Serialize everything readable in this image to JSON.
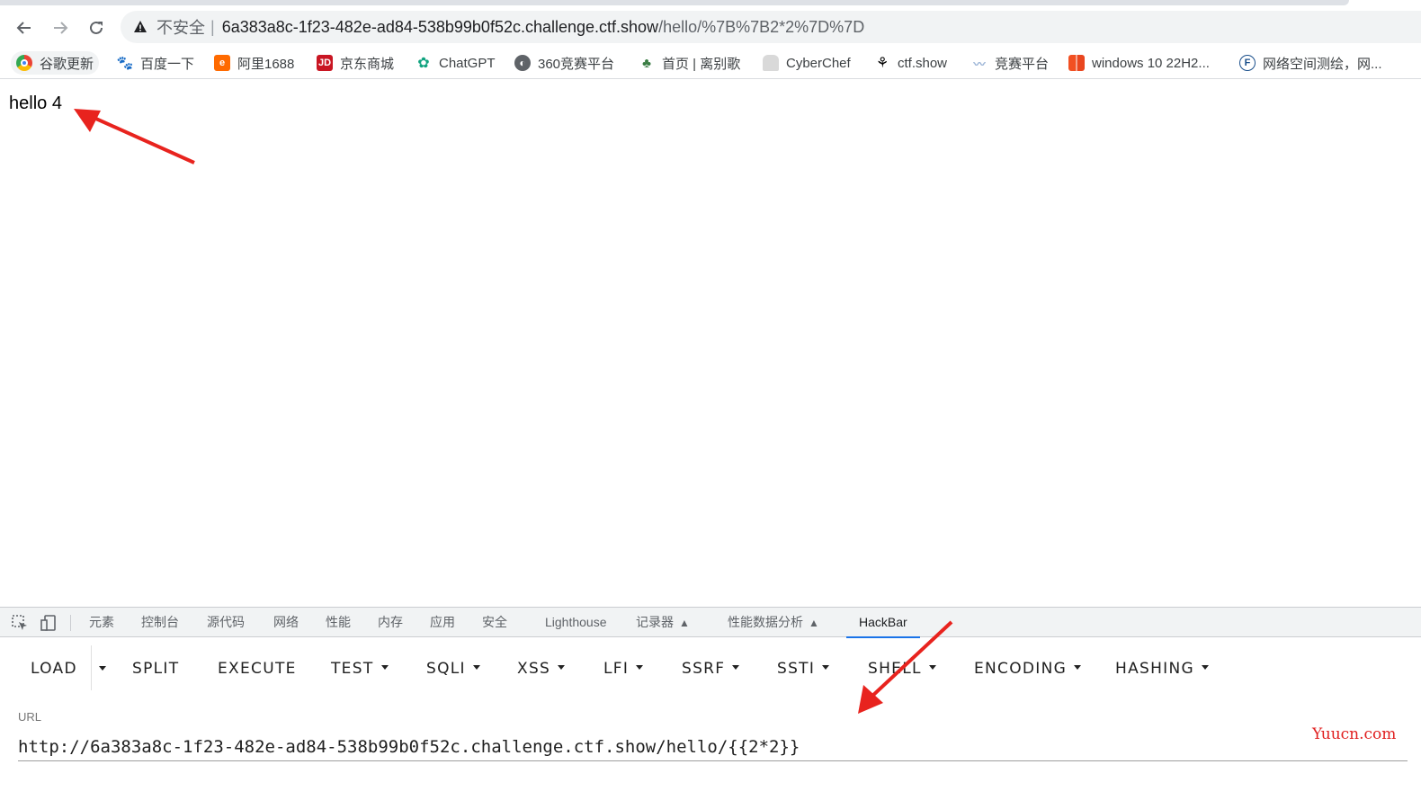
{
  "browser": {
    "address": {
      "insecure_label": "不安全",
      "separator": "|",
      "host": "6a383a8c-1f23-482e-ad84-538b99b0f52c.challenge.ctf.show",
      "path": "/hello/%7B%7B2*2%7D%7D"
    },
    "bookmarks": [
      {
        "label": "谷歌更新",
        "icon": "chrome-icon"
      },
      {
        "label": "百度一下",
        "icon": "baidu-icon"
      },
      {
        "label": "阿里1688",
        "icon": "ali1688-icon"
      },
      {
        "label": "京东商城",
        "icon": "jd-icon"
      },
      {
        "label": "ChatGPT",
        "icon": "chatgpt-icon"
      },
      {
        "label": "360竞赛平台",
        "icon": "globe-icon"
      },
      {
        "label": "首页 | 离别歌",
        "icon": "plant-icon"
      },
      {
        "label": "CyberChef",
        "icon": "chef-hat-icon"
      },
      {
        "label": "ctf.show",
        "icon": "ctfshow-icon"
      },
      {
        "label": "竞赛平台",
        "icon": "wings-icon"
      },
      {
        "label": "windows 10 22H2...",
        "icon": "windows-icon"
      },
      {
        "label": "网络空间测绘，网...",
        "icon": "fofa-icon"
      }
    ]
  },
  "page": {
    "text": "hello 4"
  },
  "devtools": {
    "tabs": [
      {
        "label": "元素"
      },
      {
        "label": "控制台"
      },
      {
        "label": "源代码"
      },
      {
        "label": "网络"
      },
      {
        "label": "性能"
      },
      {
        "label": "内存"
      },
      {
        "label": "应用"
      },
      {
        "label": "安全"
      },
      {
        "label": "Lighthouse"
      },
      {
        "label": "记录器"
      },
      {
        "label": "性能数据分析"
      },
      {
        "label": "HackBar"
      }
    ],
    "active_tab": "HackBar"
  },
  "hackbar": {
    "buttons": [
      {
        "label": "LOAD"
      },
      {
        "label": "SPLIT"
      },
      {
        "label": "EXECUTE"
      },
      {
        "label": "TEST"
      },
      {
        "label": "SQLI"
      },
      {
        "label": "XSS"
      },
      {
        "label": "LFI"
      },
      {
        "label": "SSRF"
      },
      {
        "label": "SSTI"
      },
      {
        "label": "SHELL"
      },
      {
        "label": "ENCODING"
      },
      {
        "label": "HASHING"
      }
    ],
    "url_label": "URL",
    "url_value": "http://6a383a8c-1f23-482e-ad84-538b99b0f52c.challenge.ctf.show/hello/{{2*2}}"
  },
  "watermark": "Yuucn.com",
  "colors": {
    "annotation_arrow": "#e8231e",
    "active_tab_underline": "#1a73e8",
    "watermark": "#e02020"
  }
}
